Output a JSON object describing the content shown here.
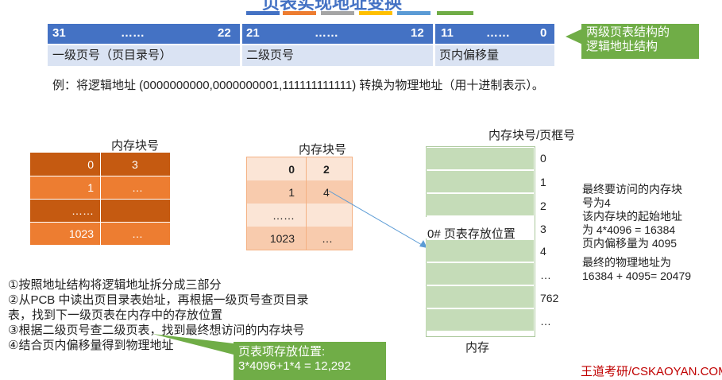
{
  "header": {
    "title_partial": "页表实现地址变换",
    "bar_colors": [
      "#4472c4",
      "#ed7d31",
      "#a5a5a5",
      "#ffc000",
      "#5b9bd5",
      "#70ad47"
    ]
  },
  "address": {
    "fields": [
      {
        "high": "31",
        "dots": "……",
        "low": "22",
        "name": "一级页号（页目录号）"
      },
      {
        "high": "21",
        "dots": "……",
        "low": "12",
        "name": "二级页号"
      },
      {
        "high": "11",
        "dots": "……",
        "low": "0",
        "name": "页内偏移量"
      }
    ],
    "callout": [
      "两级页表结构的",
      "逻辑地址结构"
    ]
  },
  "example": "例：将逻辑地址 (0000000000,0000000001,111111111111) 转换为物理地址（用十进制表示）。",
  "table1": {
    "caption": "内存块号",
    "rows": [
      [
        "0",
        "3"
      ],
      [
        "1",
        "…"
      ],
      [
        "……",
        ""
      ],
      [
        "1023",
        "…"
      ]
    ]
  },
  "table2": {
    "caption": "内存块号",
    "rows": [
      [
        "0",
        "2"
      ],
      [
        "1",
        "4"
      ],
      [
        "……",
        ""
      ],
      [
        "1023",
        "…"
      ]
    ]
  },
  "memory": {
    "caption": "内存块号/页框号",
    "labels": [
      "0",
      "1",
      "2",
      "3",
      "4",
      "…",
      "762",
      "…"
    ],
    "slot_label": "0# 页表存放位置",
    "footer": "内存"
  },
  "result": {
    "lines": [
      "最终要访问的内存块",
      "号为4",
      "该内存块的起始地址",
      "为 4*4096 = 16384",
      "页内偏移量为 4095",
      "最终的物理地址为",
      "16384 + 4095= 20479"
    ]
  },
  "steps": [
    "①按照地址结构将逻辑地址拆分成三部分",
    "②从PCB 中读出页目录表始址，再根据一级页号查页目录",
    "表，找到下一级页表在内存中的存放位置",
    "③根据二级页号查二级页表，找到最终想访问的内存块号",
    "④结合页内偏移量得到物理地址"
  ],
  "callout2": [
    "页表项存放位置:",
    "3*4096+1*4 = 12,292"
  ],
  "footer_brand": "王道考研/CSKAOYAN.COM"
}
